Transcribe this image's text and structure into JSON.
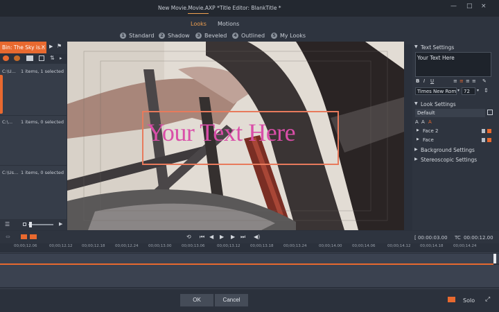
{
  "window": {
    "project_title": "New Movie.Movie.AXP *",
    "editor_title": "Title Editor: BlankTitle *",
    "min_label": "—",
    "max_label": "□",
    "close_label": "×"
  },
  "tabs": [
    {
      "label": "Looks",
      "active": true
    },
    {
      "label": "Motions",
      "active": false
    }
  ],
  "subtabs": [
    {
      "num": "1",
      "label": "Standard"
    },
    {
      "num": "2",
      "label": "Shadow"
    },
    {
      "num": "3",
      "label": "Beveled"
    },
    {
      "num": "4",
      "label": "Outlined"
    },
    {
      "num": "5",
      "label": "My Looks"
    }
  ],
  "left_panel": {
    "tab_label": "Bin: The Sky is...",
    "tab_close": "×",
    "rows": [
      {
        "path": "C:\\U...",
        "status": "1 items, 1 selected"
      },
      {
        "path": "C:\\...",
        "status": "1 items, 0 selected"
      },
      {
        "path": "C:\\Us...",
        "status": "1 items, 0 selected"
      }
    ]
  },
  "preview": {
    "overlay_text": "Your Text Here"
  },
  "right_panel": {
    "text_settings_label": "Text Settings",
    "text_value": "Your Text Here",
    "format_labels": {
      "bold": "B",
      "italic": "I",
      "underline": "U"
    },
    "font_name": "Times New Rom",
    "font_size": "72",
    "look_settings_label": "Look Settings",
    "look_value": "Default",
    "faces": [
      "Face 2",
      "Face"
    ],
    "background_settings_label": "Background Settings",
    "stereoscopic_settings_label": "Stereoscopic Settings"
  },
  "transport": {
    "in_timecode": "[ 00:00:03.00",
    "tc_label": "TC",
    "out_timecode": "00:00:12.00"
  },
  "ruler_ticks": [
    "00;00;12.06",
    "00;00;12.12",
    "00;00;12.18",
    "00;00;12.24",
    "00;00;13.00",
    "00;00;13.06",
    "00;00;13.12",
    "00;00;13.18",
    "00;00;13.24",
    "00;00;14.00",
    "00;00;14.06",
    "00;00;14.12",
    "00;00;14.18",
    "00;00;14.24"
  ],
  "buttons": {
    "ok_label": "OK",
    "cancel_label": "Cancel",
    "solo_label": "Solo"
  },
  "colors": {
    "accent": "#e8692f",
    "title_text": "#d94ea8",
    "overlay_box": "#e87a5c"
  }
}
